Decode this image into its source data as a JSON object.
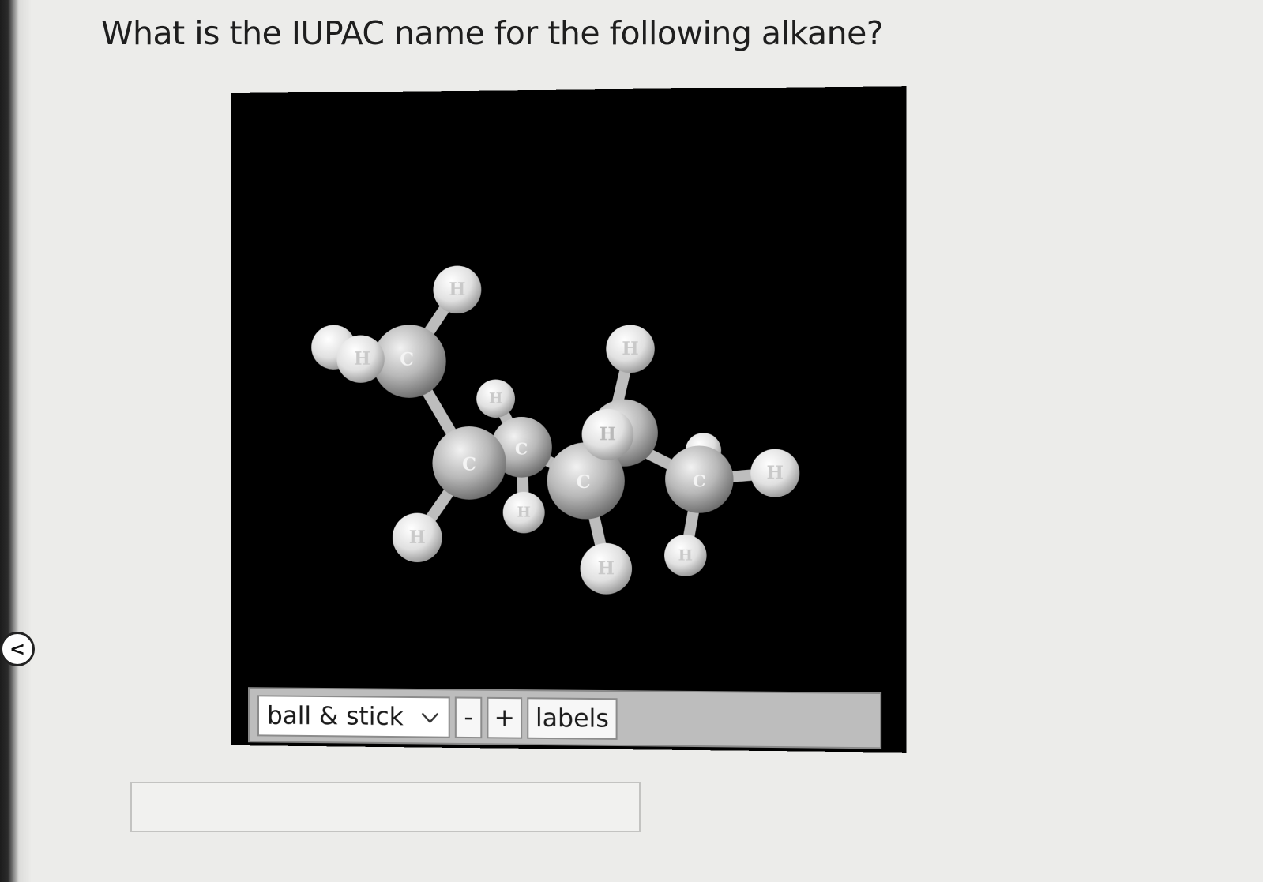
{
  "question": {
    "text": "What is the IUPAC name for the following alkane?"
  },
  "nav": {
    "back_glyph": "<"
  },
  "viewer": {
    "background": "#000000",
    "atom_color": "#d9d9d9",
    "atom_labels": {
      "carbon": "C",
      "hydrogen": "H"
    },
    "controls": {
      "render_mode": "ball & stick",
      "zoom_out_label": "-",
      "zoom_in_label": "+",
      "labels_button": "labels"
    }
  },
  "answer": {
    "value": "",
    "placeholder": ""
  }
}
